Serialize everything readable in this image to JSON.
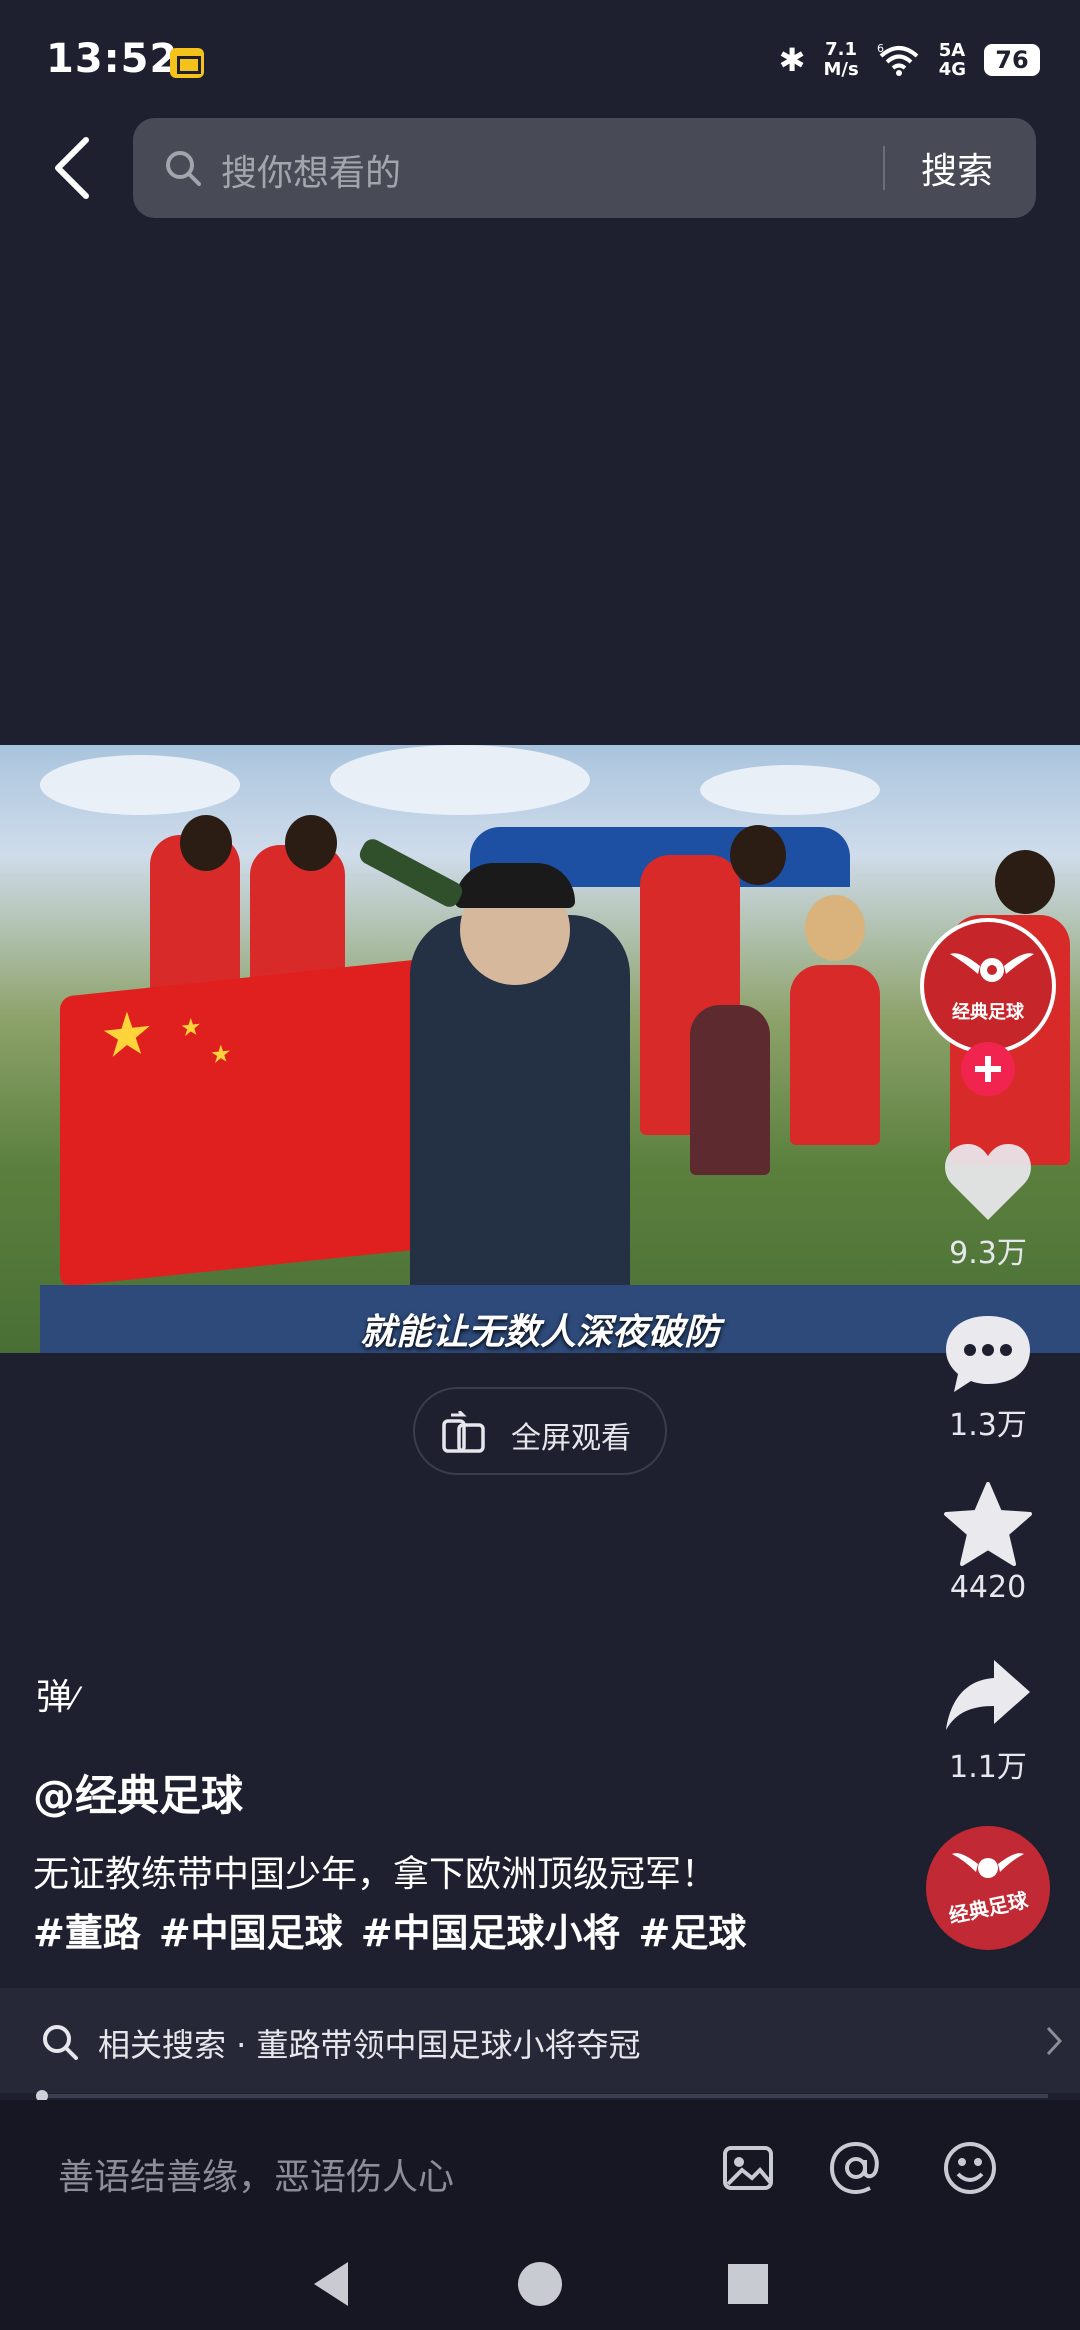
{
  "status": {
    "time": "13:52",
    "net_speed_top": "7.1",
    "net_speed_bottom": "M/s",
    "signal_top": "5A",
    "signal_bottom": "4G",
    "wifi_badge": "6",
    "battery": "76"
  },
  "search": {
    "placeholder": "搜你想看的",
    "submit_label": "搜索"
  },
  "video": {
    "subtitle": "就能让无数人深夜破防",
    "fullscreen_label": "全屏观看"
  },
  "creator": {
    "avatar_text": "经典足球"
  },
  "actions": {
    "likes": "9.3万",
    "comments": "1.3万",
    "favorites": "4420",
    "shares": "1.1万"
  },
  "post": {
    "danmaku_label": "弹",
    "author": "@经典足球",
    "description": "无证教练带中国少年，拿下欧洲顶级冠军！",
    "tags": [
      "#董路",
      "#中国足球",
      "#中国足球小将",
      "#足球"
    ]
  },
  "related": {
    "label": "相关搜索 · 董路带领中国足球小将夺冠"
  },
  "progress": {
    "fraction": 0.0
  },
  "comment": {
    "placeholder": "善语结善缘，恶语伤人心"
  },
  "colors": {
    "background": "#1e2030",
    "search_bg": "#484a55",
    "follow_red": "#f0244f",
    "brand_red": "#c6262a"
  },
  "icons": {
    "back": "back-arrow-icon",
    "search": "search-icon",
    "fullscreen": "fullscreen-icon",
    "like": "heart-icon",
    "comment": "comment-bubble-icon",
    "favorite": "star-icon",
    "share": "share-arrow-icon",
    "image": "image-icon",
    "mention": "at-icon",
    "emoji": "emoji-icon"
  }
}
